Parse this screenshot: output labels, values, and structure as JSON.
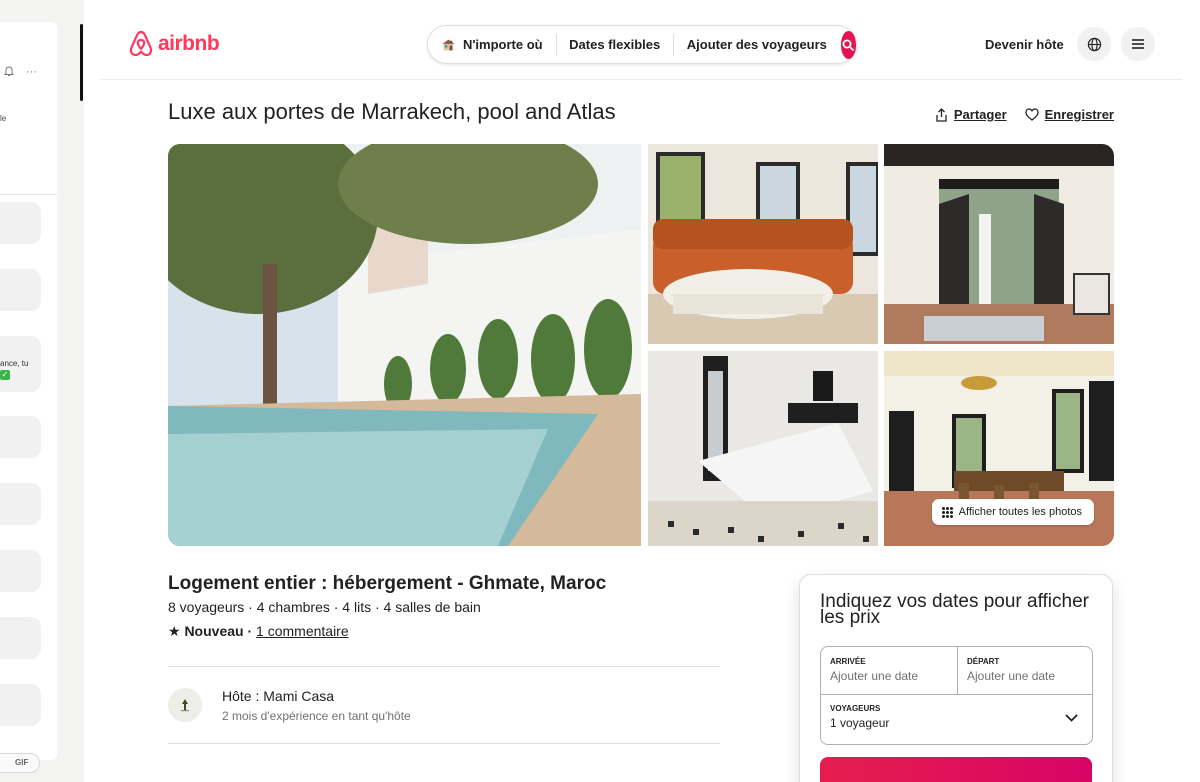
{
  "left_panel": {
    "text_fragment_a": "le",
    "text_fragment_b": "ance, tu",
    "gif_label": "GIF"
  },
  "header": {
    "logo_text": "airbnb",
    "search": {
      "where": "N'importe où",
      "when": "Dates flexibles",
      "who": "Ajouter des voyageurs"
    },
    "host_link": "Devenir hôte"
  },
  "listing": {
    "title": "Luxe aux portes de Marrakech, pool and Atlas",
    "share_label": "Partager",
    "save_label": "Enregistrer",
    "show_all_photos": "Afficher toutes les photos",
    "subtitle": "Logement entier : hébergement - Ghmate, Maroc",
    "specs": "8 voyageurs · 4 chambres · 4 lits · 4 salles de bain",
    "rating_new": "★ Nouveau",
    "rating_sep": " · ",
    "review_link": "1 commentaire",
    "host_name": "Hôte : Mami Casa",
    "host_experience": "2 mois d'expérience en tant qu'hôte"
  },
  "booking": {
    "title": "Indiquez vos dates pour afficher les prix",
    "checkin_label": "ARRIVÉE",
    "checkin_placeholder": "Ajouter une date",
    "checkout_label": "DÉPART",
    "checkout_placeholder": "Ajouter une date",
    "guests_label": "VOYAGEURS",
    "guests_value": "1 voyageur"
  },
  "colors": {
    "brand": "#ff385c",
    "search_button": "#e5134f"
  },
  "icons": [
    "bell-icon",
    "more-icon",
    "airbnb-logo-icon",
    "house-icon",
    "search-icon",
    "globe-icon",
    "menu-icon",
    "share-icon",
    "heart-icon",
    "grid-dots-icon",
    "chevron-down-icon"
  ]
}
